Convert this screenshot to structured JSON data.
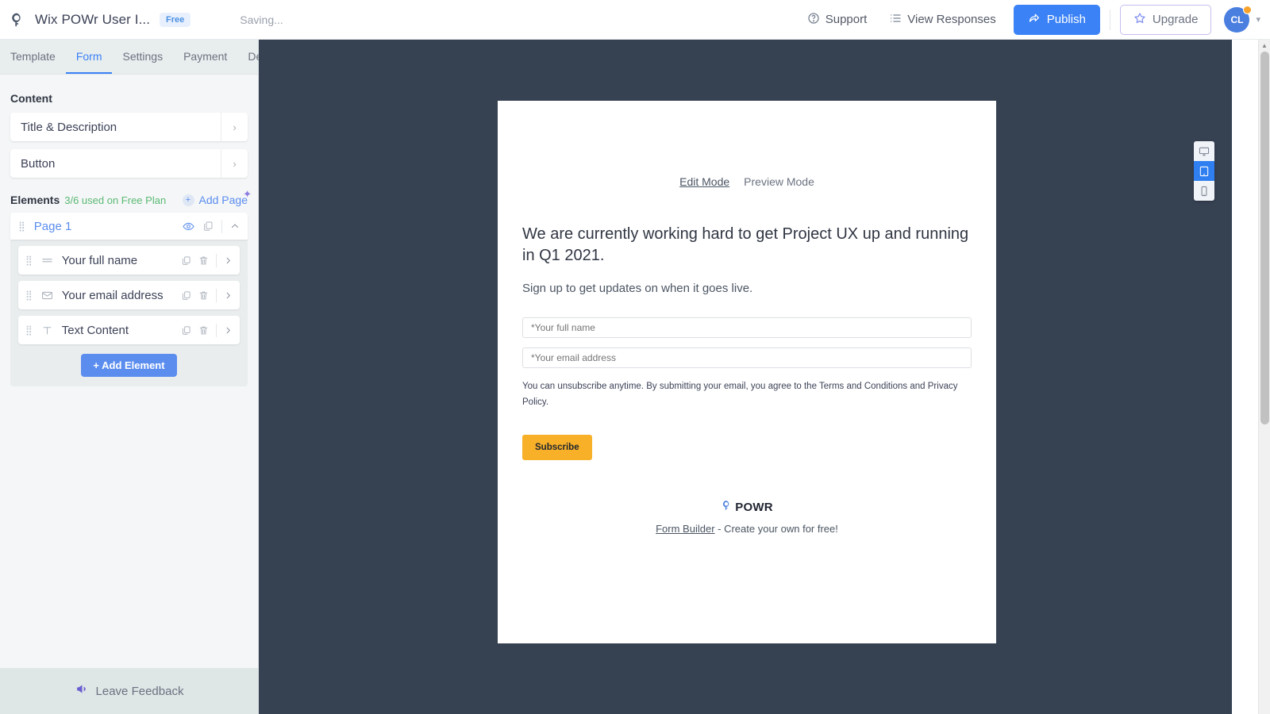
{
  "topbar": {
    "logo_icon": "powr-logo-icon",
    "app_title": "Wix POWr User I...",
    "plan_badge": "Free",
    "save_status": "Saving...",
    "support_label": "Support",
    "support_icon": "question-circle-icon",
    "view_responses_label": "View Responses",
    "view_responses_icon": "list-icon",
    "publish_label": "Publish",
    "publish_icon": "share-arrow-icon",
    "publish_color": "#3b82f6",
    "upgrade_label": "Upgrade",
    "upgrade_icon": "star-icon",
    "avatar_initials": "CL",
    "avatar_color": "#4a7fe0",
    "avatar_badge_color": "#f7a32b",
    "caret_icon": "chevron-down-icon"
  },
  "sidebar": {
    "tabs": [
      {
        "label": "Template",
        "active": false
      },
      {
        "label": "Form",
        "active": true
      },
      {
        "label": "Settings",
        "active": false
      },
      {
        "label": "Payment",
        "active": false
      },
      {
        "label": "Design",
        "active": false
      }
    ],
    "content_label": "Content",
    "content_rows": [
      {
        "label": "Title & Description"
      },
      {
        "label": "Button"
      }
    ],
    "elements_label": "Elements",
    "elements_usage": "3/6 used on Free Plan",
    "usage_color": "#5bb974",
    "add_page_label": "Add Page",
    "page": {
      "name": "Page 1",
      "eye_icon": "eye-icon",
      "duplicate_icon": "duplicate-icon",
      "collapse_icon": "chevron-up-icon"
    },
    "elements": [
      {
        "label": "Your full name",
        "icon": "text-field-icon"
      },
      {
        "label": "Your email address",
        "icon": "envelope-icon"
      },
      {
        "label": "Text Content",
        "icon": "text-t-icon"
      }
    ],
    "add_element_label": "+ Add Element",
    "feedback_label": "Leave Feedback",
    "feedback_icon": "megaphone-icon"
  },
  "canvas": {
    "background_color": "#364152",
    "modes": [
      {
        "label": "Edit Mode",
        "active": true
      },
      {
        "label": "Preview Mode",
        "active": false
      }
    ],
    "form": {
      "title": "We are currently working hard to get Project UX up and running in Q1 2021.",
      "subtitle": "Sign up to get updates on when it goes live.",
      "fields": [
        {
          "placeholder": "*Your full name",
          "value": ""
        },
        {
          "placeholder": "*Your email address",
          "value": ""
        }
      ],
      "disclaimer": "You can unsubscribe anytime. By submitting your email, you agree to the Terms and Conditions and Privacy Policy.",
      "submit_label": "Subscribe",
      "submit_color": "#f7b027"
    },
    "footer": {
      "brand": "POWR",
      "link_label": "Form Builder",
      "credit_rest": " - Create your own for free!"
    }
  },
  "device_switch": [
    {
      "icon": "desktop-icon",
      "active": false
    },
    {
      "icon": "tablet-icon",
      "active": true
    },
    {
      "icon": "mobile-icon",
      "active": false
    }
  ]
}
